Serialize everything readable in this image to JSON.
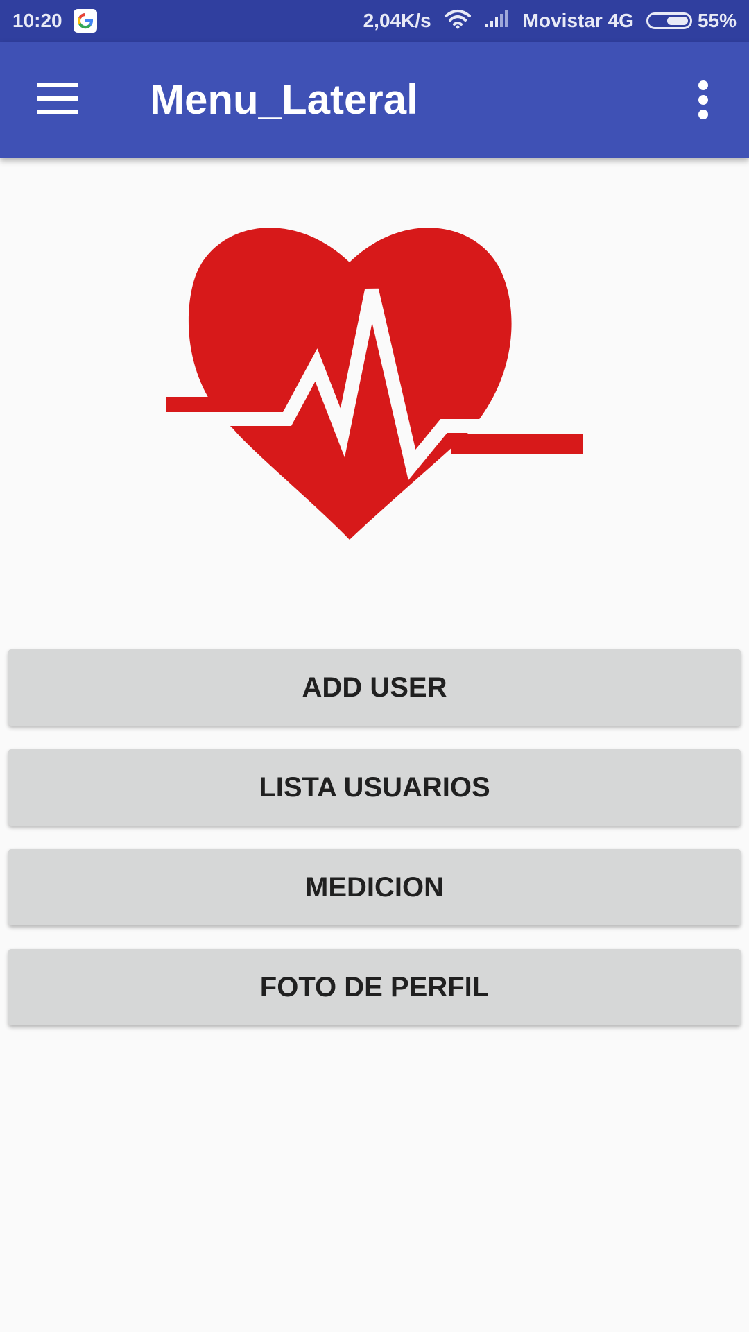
{
  "status_bar": {
    "time": "10:20",
    "network_speed": "2,04K/s",
    "carrier": "Movistar 4G",
    "battery": "55%",
    "battery_level": 0.55,
    "icons": [
      "google-icon",
      "wifi-icon",
      "signal-icon",
      "battery-icon"
    ]
  },
  "app_bar": {
    "title": "Menu_Lateral",
    "nav_icon": "menu-icon",
    "overflow_icon": "more-vert-icon"
  },
  "logo": {
    "icon": "heart-pulse-icon",
    "color": "#D7191A"
  },
  "buttons": [
    {
      "label": "ADD USER"
    },
    {
      "label": "LISTA USUARIOS"
    },
    {
      "label": "MEDICION"
    },
    {
      "label": "FOTO DE PERFIL"
    }
  ],
  "colors": {
    "primary": "#3F51B5",
    "primary_dark": "#303F9F",
    "background": "#FAFAFA",
    "button": "#D6D7D7",
    "heart": "#D7191A"
  }
}
